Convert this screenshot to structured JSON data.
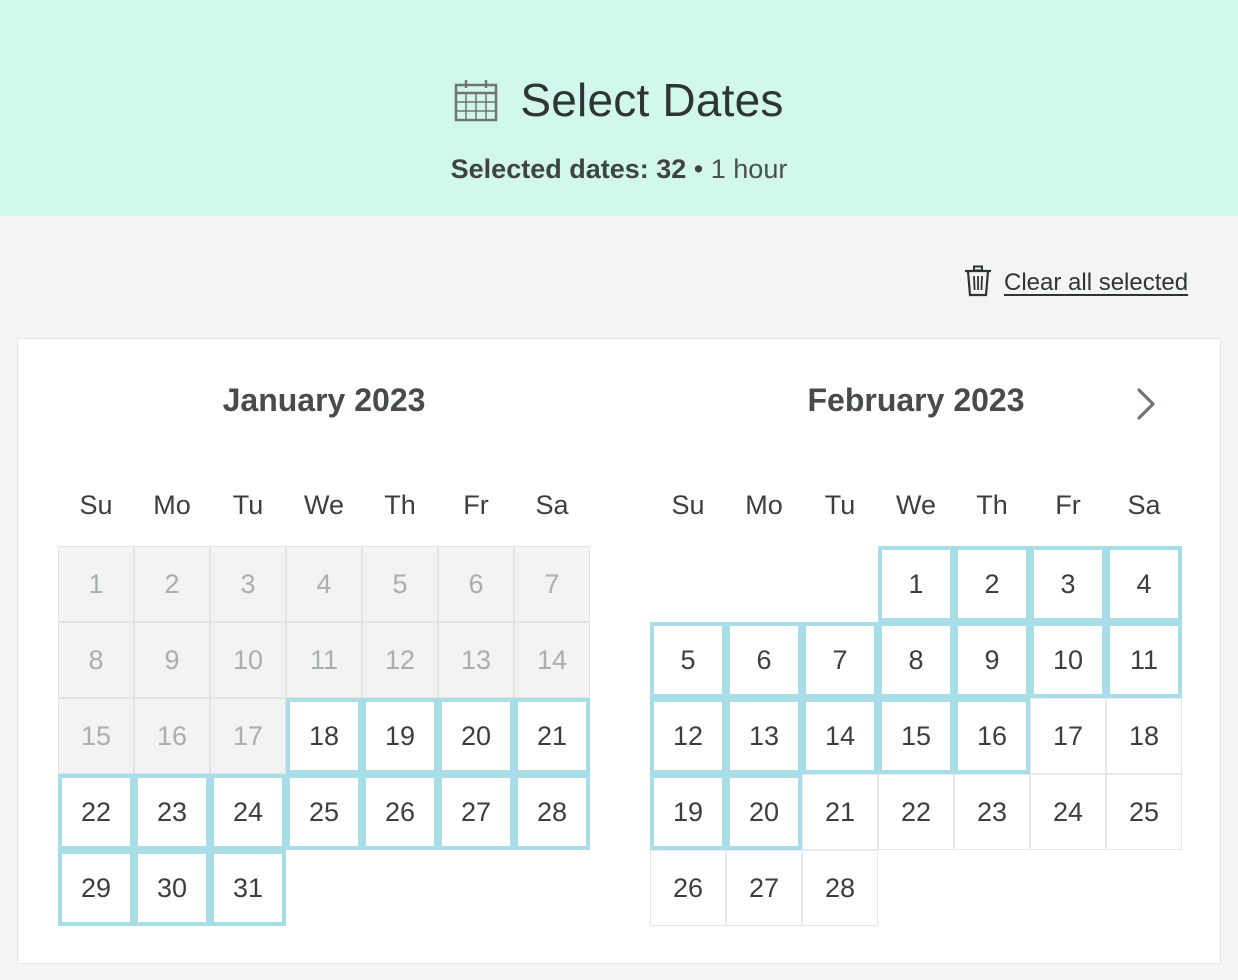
{
  "header": {
    "title": "Select Dates",
    "selected_label": "Selected dates: 32",
    "separator": "•",
    "duration": "1 hour",
    "icon": "calendar-icon",
    "background_color": "#d2f8ee"
  },
  "toolbar": {
    "clear_label": "Clear all selected",
    "clear_icon": "trash-icon"
  },
  "calendar": {
    "weekdays": [
      "Su",
      "Mo",
      "Tu",
      "We",
      "Th",
      "Fr",
      "Sa"
    ],
    "selected_border_color": "#a9dde8",
    "next_icon": "chevron-right-icon",
    "months": [
      {
        "title": "January 2023",
        "first_weekday": 0,
        "days_in_month": 31,
        "past_through": 17,
        "selected": [
          18,
          19,
          20,
          21,
          22,
          23,
          24,
          25,
          26,
          27,
          28,
          29,
          30,
          31
        ]
      },
      {
        "title": "February 2023",
        "first_weekday": 3,
        "days_in_month": 28,
        "past_through": 0,
        "selected": [
          1,
          2,
          3,
          4,
          5,
          6,
          7,
          8,
          9,
          10,
          11,
          12,
          13,
          14,
          15,
          16,
          19,
          20
        ]
      }
    ]
  }
}
